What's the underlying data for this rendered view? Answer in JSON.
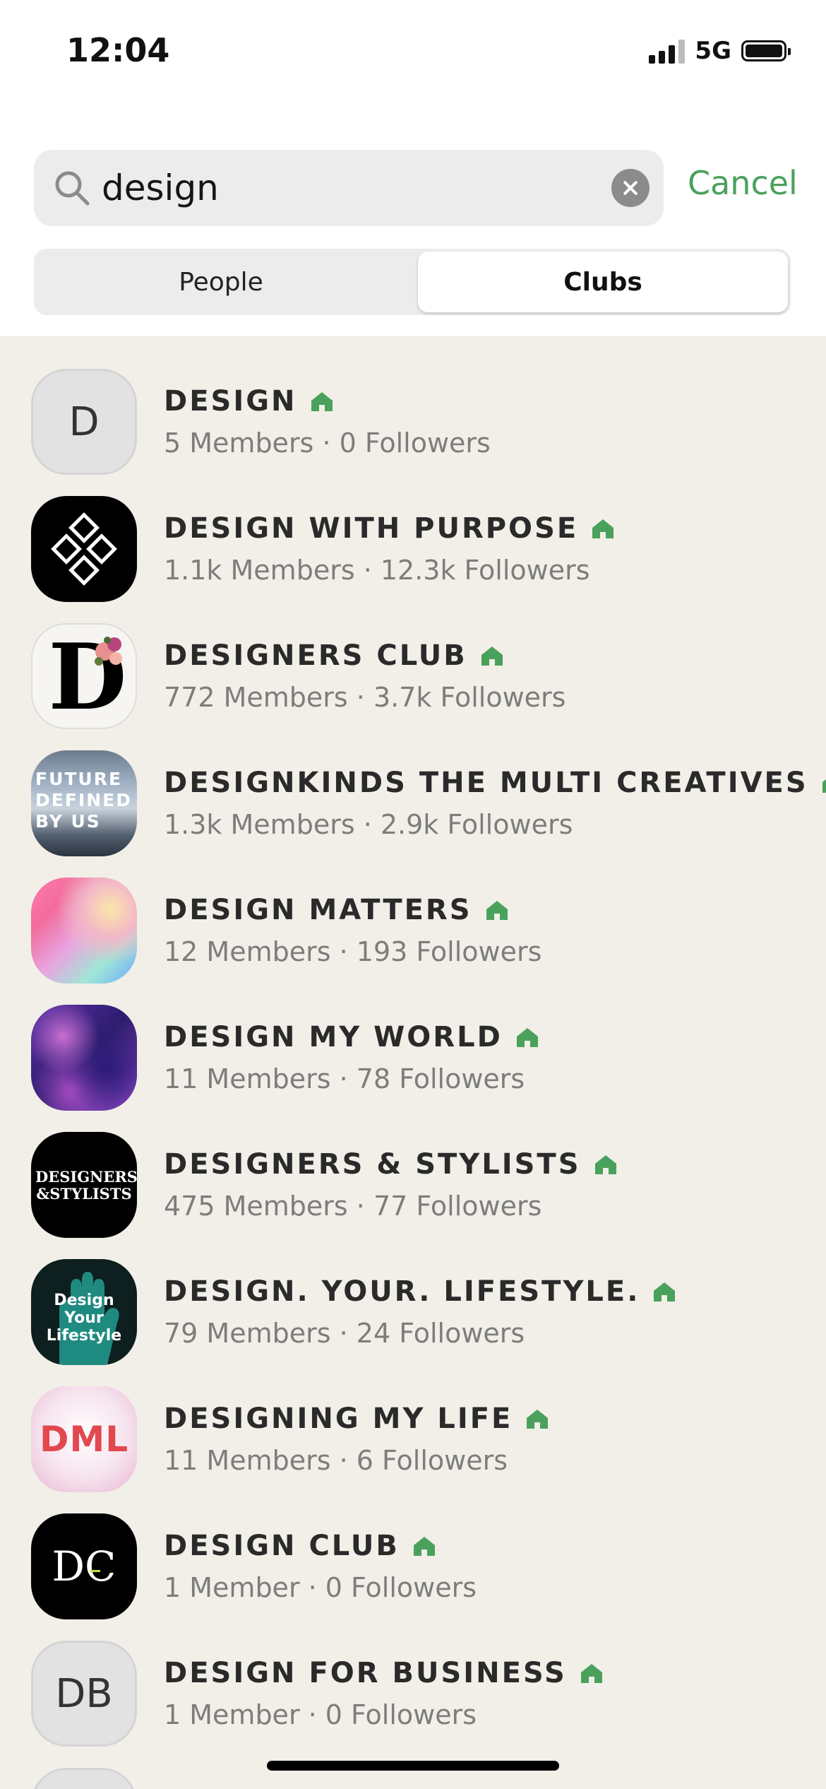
{
  "status_bar": {
    "time": "12:04",
    "network": "5G"
  },
  "search": {
    "value": "design",
    "cancel_label": "Cancel"
  },
  "tabs": [
    {
      "label": "People",
      "selected": false
    },
    {
      "label": "Clubs",
      "selected": true
    }
  ],
  "clubs": [
    {
      "name": "DESIGN",
      "meta": "5 Members · 0 Followers",
      "avatar_text": "D"
    },
    {
      "name": "DESIGN WITH PURPOSE",
      "meta": "1.1k Members · 12.3k Followers"
    },
    {
      "name": "DESIGNERS CLUB",
      "meta": "772 Members · 3.7k Followers",
      "avatar_text": "D"
    },
    {
      "name": "DESIGNKINDS THE MULTI CREATIVES",
      "meta": "1.3k Members · 2.9k Followers",
      "avatar_text": "FUTURE DEFINED BY US"
    },
    {
      "name": "DESIGN MATTERS",
      "meta": "12 Members · 193 Followers"
    },
    {
      "name": "DESIGN MY WORLD",
      "meta": "11 Members · 78 Followers"
    },
    {
      "name": "DESIGNERS & STYLISTS",
      "meta": "475 Members · 77 Followers",
      "avatar_text": "DESIGNERS &STYLISTS"
    },
    {
      "name": "DESIGN. YOUR. LIFESTYLE.",
      "meta": "79 Members · 24 Followers",
      "avatar_text": "Design Your Lifestyle"
    },
    {
      "name": "DESIGNING MY LIFE",
      "meta": "11 Members · 6 Followers",
      "avatar_text": "DML"
    },
    {
      "name": "DESIGN CLUB",
      "meta": "1 Member · 0 Followers",
      "avatar_text": "DC"
    },
    {
      "name": "DESIGN FOR BUSINESS",
      "meta": "1 Member · 0 Followers",
      "avatar_text": "DB"
    }
  ],
  "colors": {
    "accent": "#4aa15c",
    "background": "#f1efe7",
    "name_text": "#2a2a2a",
    "meta_text": "#7d7d7d"
  },
  "icons": {
    "search": "search-icon",
    "clear": "clear-icon",
    "club_badge": "house-icon"
  }
}
